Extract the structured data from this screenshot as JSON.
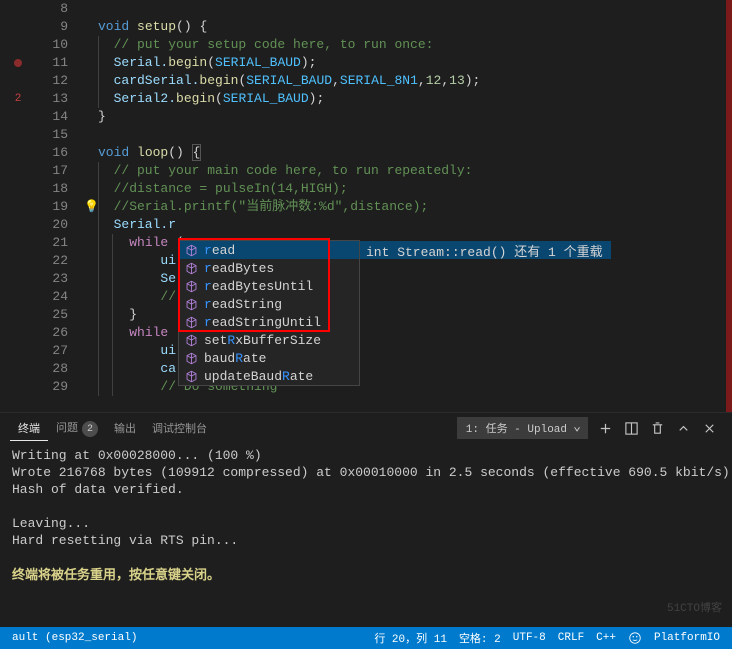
{
  "lines": {
    "8": "",
    "9_void": "void",
    "9_setup": "setup",
    "9_rest": "() {",
    "10": "  // put your setup code here, to run once:",
    "11_a": "  Serial.",
    "11_fn": "begin",
    "11_b": "(",
    "11_c": "SERIAL_BAUD",
    "11_d": ");",
    "12_a": "  cardSerial.",
    "12_fn": "begin",
    "12_b": "(",
    "12_c1": "SERIAL_BAUD",
    "12_d": ",",
    "12_c2": "SERIAL_8N1",
    "12_e": ",",
    "12_n1": "12",
    "12_f": ",",
    "12_n2": "13",
    "12_g": ");",
    "13_a": "  Serial2.",
    "13_fn": "begin",
    "13_b": "(",
    "13_c": "SERIAL_BAUD",
    "13_d": ");",
    "14": "}",
    "15": "",
    "16_void": "void",
    "16_loop": "loop",
    "16_rest": "() ",
    "16_brace": "{",
    "17": "  // put your main code here, to run repeatedly:",
    "18": "  //distance = pulseIn(14,HIGH);",
    "19": "  //Serial.printf(\"当前脉冲数:%d\",distance);",
    "20": "  Serial.r",
    "21_a": "    ",
    "21_while": "while",
    "21_b": " (",
    "22_a": "        ",
    "22_ui": "ui",
    "23_a": "        ",
    "23_se": "Se",
    "24_a": "        ",
    "24_c": "//",
    "25": "    }",
    "26_a": "    ",
    "26_while": "while",
    "26_b": " (",
    "27_a": "        ",
    "27_ui": "ui",
    "28_a": "        ",
    "28_ca": "ca",
    "29": "        // Do something"
  },
  "line_numbers": [
    "8",
    "9",
    "10",
    "11",
    "12",
    "13",
    "14",
    "15",
    "16",
    "17",
    "18",
    "19",
    "20",
    "21",
    "22",
    "23",
    "24",
    "25",
    "26",
    "27",
    "28",
    "29"
  ],
  "breakpoints": {
    "11": "dot",
    "13": "2"
  },
  "suggest_items": [
    {
      "text": "read",
      "match": "r"
    },
    {
      "text": "readBytes",
      "match": "r"
    },
    {
      "text": "readBytesUntil",
      "match": "r"
    },
    {
      "text": "readString",
      "match": "r"
    },
    {
      "text": "readStringUntil",
      "match": "r"
    },
    {
      "text": "setRxBufferSize",
      "match": "R"
    },
    {
      "text": "baudRate",
      "match": "R"
    },
    {
      "text": "updateBaudRate",
      "match": "R"
    }
  ],
  "suggest_doc": "int Stream::read() 还有 1 个重载",
  "suggest_selected": 0,
  "panel": {
    "tabs": {
      "terminal": "终端",
      "problems": "问题",
      "problems_count": "2",
      "output": "输出",
      "debug": "调试控制台"
    },
    "task_selected": "1: 任务 - Upload",
    "output_lines": [
      "Writing at 0x00028000... (100 %)",
      "Wrote 216768 bytes (109912 compressed) at 0x00010000 in 2.5 seconds (effective 690.5 kbit/s).",
      "Hash of data verified.",
      "",
      "Leaving...",
      "Hard resetting via RTS pin..."
    ],
    "close_hint": "终端将被任务重用，按任意键关闭。"
  },
  "status": {
    "left": "ault (esp32_serial)",
    "ln_col": "行 20，列 11",
    "spaces": "空格: 2",
    "encoding": "UTF-8",
    "eol": "CRLF",
    "lang": "C++",
    "platformio": "PlatformIO"
  },
  "watermark": "51CTO博客"
}
